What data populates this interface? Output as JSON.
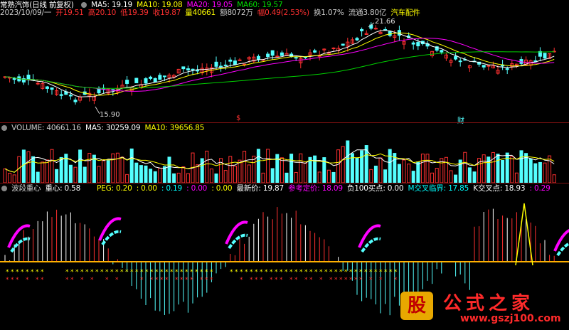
{
  "price_pane": {
    "info": {
      "name": "常熟汽饰(日线 前复权)",
      "date": "2023/10/09/一",
      "open": "开19.51",
      "high": "高20.10",
      "low": "低19.39",
      "close": "收19.87",
      "volume": "量40661",
      "amount": "额8072万",
      "change": "幅0.49(2.53%)",
      "turnover": "换1.07%",
      "float": "流通3.80亿",
      "sector": "汽车配件"
    },
    "ma": [
      {
        "label": "MA5: 19.19",
        "color": "#ffffff"
      },
      {
        "label": "MA10: 19.08",
        "color": "#ffff00"
      },
      {
        "label": "MA20: 19.05",
        "color": "#ff00ff"
      },
      {
        "label": "MA60: 19.57",
        "color": "#00e000"
      }
    ],
    "high_label": "21.66",
    "low_label": "15.90",
    "marker_s": "$",
    "marker_cai": "财"
  },
  "volume_pane": {
    "title": "VOLUME: 40661.16",
    "ma5": "MA5: 30259.09",
    "ma10": "MA10: 39656.85"
  },
  "indicator_pane": {
    "name": "波段重心",
    "items": [
      {
        "text": "重心: 0.58",
        "color": "#ffffff"
      },
      {
        "text": "PEG: 0.20",
        "color": "#ffff00"
      },
      {
        "text": ": 0.00",
        "color": "#ffff00"
      },
      {
        "text": ": 0.19",
        "color": "#00ffff"
      },
      {
        "text": ": 0.00",
        "color": "#ff00ff"
      },
      {
        "text": ": 0.00",
        "color": "#ffff00"
      },
      {
        "text": "最新价: 19.87",
        "color": "#ffffff"
      },
      {
        "text": "参考定价: 18.09",
        "color": "#ff00ff"
      },
      {
        "text": "负100买点: 0.00",
        "color": "#ffffff"
      },
      {
        "text": "M交叉临界: 17.85",
        "color": "#00ffff"
      },
      {
        "text": "K交叉点: 18.93",
        "color": "#ffffff"
      },
      {
        "text": ": 0.29",
        "color": "#ff00ff"
      }
    ]
  },
  "logo": {
    "icon_text": "股",
    "name": "公式之家",
    "url": "www.gszj100.com"
  },
  "colors": {
    "up": "#ff3030",
    "down": "#54ffff",
    "separator": "#7a1010"
  }
}
